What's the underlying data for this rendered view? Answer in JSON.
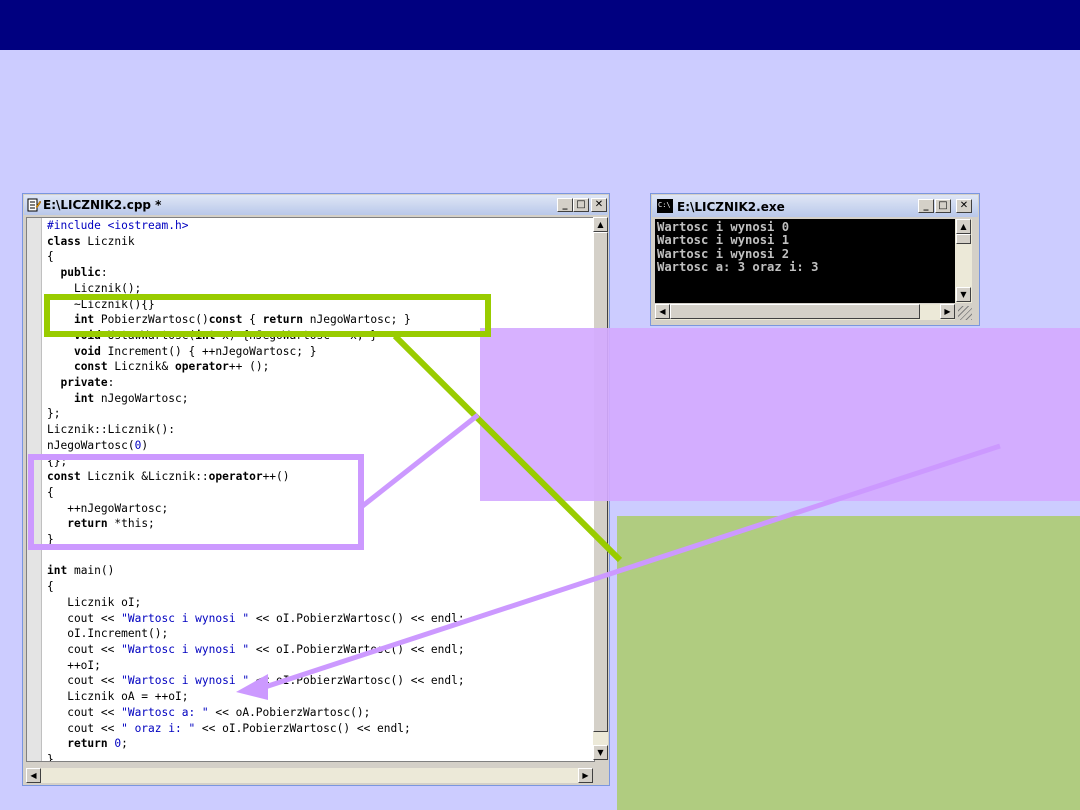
{
  "slide": {
    "colors": {
      "top_bar": "#000080",
      "background": "#ccccff",
      "purple_panel": "#d4aaff",
      "green_panel": "#b0cc80",
      "green_annotation": "#99cc00",
      "purple_annotation": "#cc99ff"
    }
  },
  "editor_window": {
    "title": "E:\\LICZNIK2.cpp *",
    "icon": "document-edit-icon",
    "controls": {
      "minimize": "_",
      "maximize": "□",
      "close": "✕"
    }
  },
  "code_lines": [
    "#include <iostream.h>",
    "class Licznik",
    "{",
    "  public:",
    "    Licznik();",
    "    ~Licznik(){}",
    "    int PobierzWartosc()const { return nJegoWartosc; }",
    "    void UstawWartosc(int x) {nJegoWartosc = x; }",
    "    void Increment() { ++nJegoWartosc; }",
    "    const Licznik& operator++ ();",
    "  private:",
    "    int nJegoWartosc;",
    "};",
    "Licznik::Licznik():",
    "nJegoWartosc(0)",
    "{};",
    "const Licznik &Licznik::operator++()",
    "{",
    "   ++nJegoWartosc;",
    "   return *this;",
    "}",
    "",
    "int main()",
    "{",
    "   Licznik oI;",
    "   cout << \"Wartosc i wynosi \" << oI.PobierzWartosc() << endl;",
    "   oI.Increment();",
    "   cout << \"Wartosc i wynosi \" << oI.PobierzWartosc() << endl;",
    "   ++oI;",
    "   cout << \"Wartosc i wynosi \" << oI.PobierzWartosc() << endl;",
    "   Licznik oA = ++oI;",
    "   cout << \"Wartosc a: \" << oA.PobierzWartosc();",
    "   cout << \" oraz i: \" << oI.PobierzWartosc() << endl;",
    "   return 0;",
    "}"
  ],
  "console_window": {
    "title": "E:\\LICZNIK2.exe",
    "icon": "console-icon",
    "icon_label": "C:\\",
    "controls": {
      "minimize": "_",
      "maximize": "□",
      "close": "✕"
    },
    "output_lines": [
      "Wartosc i wynosi 0",
      "Wartosc i wynosi 1",
      "Wartosc i wynosi 2",
      "Wartosc a: 3 oraz i: 3"
    ]
  }
}
